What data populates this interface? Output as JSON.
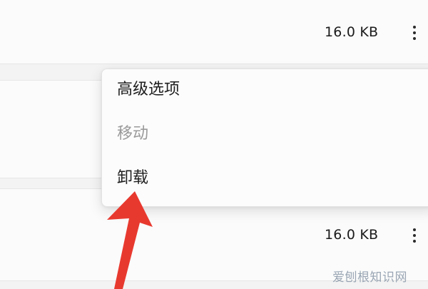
{
  "list": {
    "rows": [
      {
        "size": "16.0 KB"
      },
      {
        "size": "16.0 KB"
      }
    ]
  },
  "context_menu": {
    "items": [
      {
        "label": "高级选项",
        "enabled": true
      },
      {
        "label": "移动",
        "enabled": false
      },
      {
        "label": "卸载",
        "enabled": true
      }
    ]
  },
  "icons": {
    "more_options": "more-vertical-icon"
  },
  "annotation": {
    "arrow_color": "#e8392f"
  },
  "watermark": {
    "text": "爱刨根知识网"
  }
}
